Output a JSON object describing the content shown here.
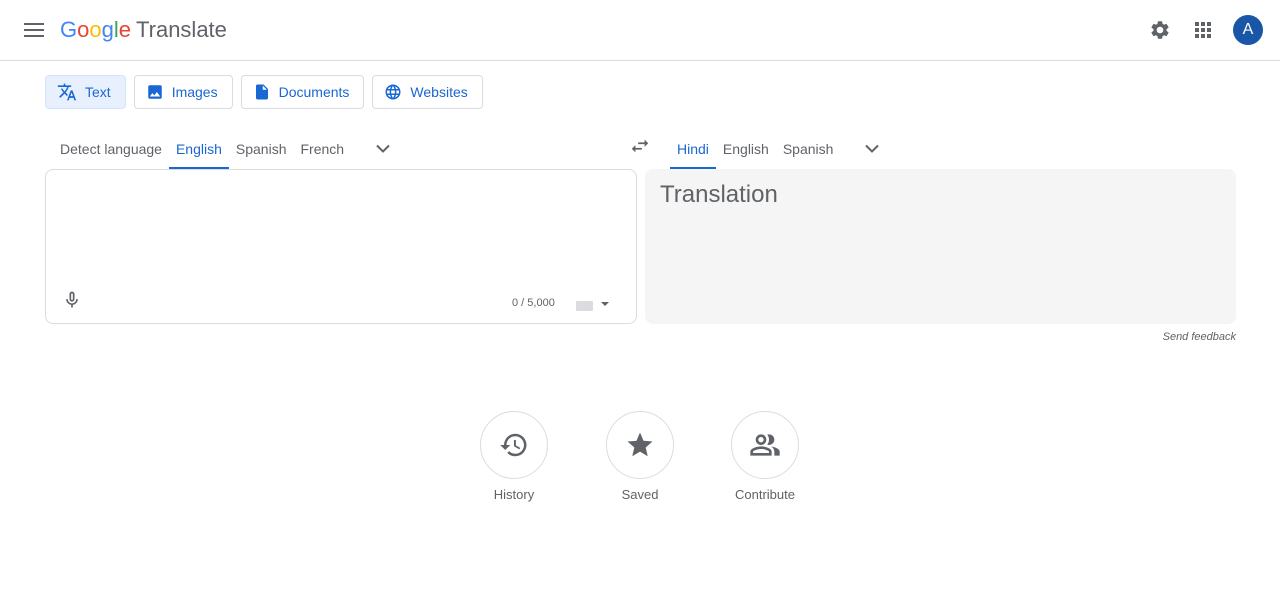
{
  "header": {
    "logo": {
      "g1": "G",
      "o1": "o",
      "o2": "o",
      "g2": "g",
      "l": "l",
      "e": "e",
      "product": "Translate"
    },
    "avatar_letter": "A",
    "icons": {
      "menu": "hamburger-menu-icon",
      "settings": "gear-icon",
      "apps": "apps-grid-icon"
    }
  },
  "mode_tabs": [
    {
      "label": "Text",
      "icon": "translate-icon",
      "active": true
    },
    {
      "label": "Images",
      "icon": "image-icon",
      "active": false
    },
    {
      "label": "Documents",
      "icon": "document-icon",
      "active": false
    },
    {
      "label": "Websites",
      "icon": "globe-icon",
      "active": false
    }
  ],
  "source_languages": [
    {
      "label": "Detect language",
      "active": false
    },
    {
      "label": "English",
      "active": true
    },
    {
      "label": "Spanish",
      "active": false
    },
    {
      "label": "French",
      "active": false
    }
  ],
  "target_languages": [
    {
      "label": "Hindi",
      "active": true
    },
    {
      "label": "English",
      "active": false
    },
    {
      "label": "Spanish",
      "active": false
    }
  ],
  "source_panel": {
    "value": "",
    "char_count": "0 / 5,000"
  },
  "target_panel": {
    "placeholder": "Translation"
  },
  "feedback": "Send feedback",
  "bottom": {
    "history": "History",
    "saved": "Saved",
    "contribute": "Contribute"
  },
  "colors": {
    "accent": "#1967d2",
    "active_tab_bg": "#e8f0fe",
    "avatar_bg": "#1a56a8",
    "border": "#dadce0",
    "target_bg": "#f5f5f5"
  }
}
